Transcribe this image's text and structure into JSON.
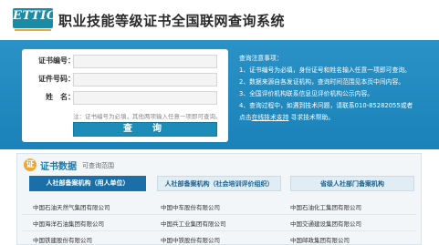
{
  "header": {
    "logo_text": "ETTIC",
    "title": "职业技能等级证书全国联网查询系统"
  },
  "form": {
    "cert_label": "证书编号：",
    "id_label": "证件号码：",
    "name_label": "姓　名：",
    "cert_value": "",
    "id_value": "",
    "name_value": "",
    "hint": "注：证书编号为必填，其他两项输入任意一项即可查询。",
    "query_button": "查　询"
  },
  "notice": {
    "title": "查询注意事项：",
    "items": [
      "1、证书编号为必填，身份证号和姓名输入任意一项即可查询。",
      "2、数据来源自各发证机构，查询时间范围见本页中间内容。",
      "3、全国评价机构联系信息见评价机构公示内容。",
      "4、查询过程中，如遇到技术问题，请联系010-85282055或者",
      "点击"
    ],
    "link_text": "在线技术支持",
    "tail_text": " 寻求技术帮助。"
  },
  "section": {
    "icon": "证",
    "title": "证书数据",
    "subtitle": "可查询范围"
  },
  "tabs": [
    {
      "label": "人社部备案机构（用人单位）",
      "active": true
    },
    {
      "label": "人社部备案机构（社会培训评价组织）",
      "active": false
    },
    {
      "label": "省级人社部门备案机构",
      "active": false
    }
  ],
  "table": {
    "rows": [
      [
        "中国石油天然气集团有限公司",
        "中国中车股份有限公司",
        "中国石油化工集团有限公司"
      ],
      [
        "中国海洋石油集团有限公司",
        "中国兵工业集团有限公司",
        "中国交通建设集团有限公司"
      ],
      [
        "中国铁建股份有限公司",
        "中国中铁股份有限公司",
        "中国邮政集团有限公司"
      ]
    ]
  },
  "colors": {
    "band": "#1a82b8",
    "accent": "#f0a630",
    "button": "#1b8db8",
    "active_tab": "#1a6fa8"
  }
}
